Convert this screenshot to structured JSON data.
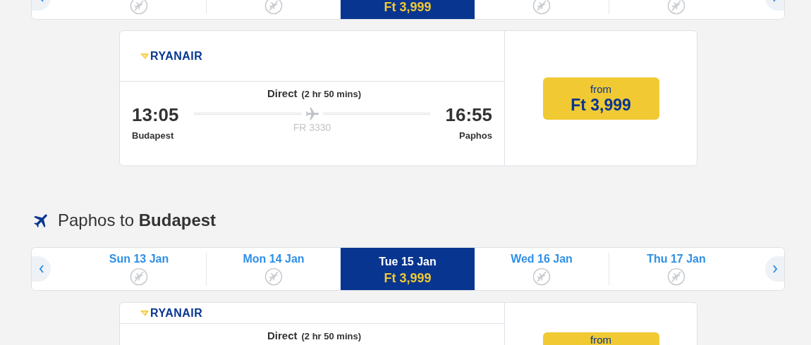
{
  "sections": [
    {
      "date_strip": {
        "days": [
          {
            "selected": false,
            "available": false
          },
          {
            "selected": false,
            "available": false
          },
          {
            "selected": true,
            "available": true,
            "price": "Ft 3,999"
          },
          {
            "selected": false,
            "available": false
          },
          {
            "selected": false,
            "available": false
          }
        ]
      },
      "flight": {
        "airline": "RYANAIR",
        "stops": "Direct",
        "duration": "(2 hr 50 mins)",
        "depart_time": "13:05",
        "depart_city": "Budapest",
        "flight_no": "FR 3330",
        "arrive_time": "16:55",
        "arrive_city": "Paphos",
        "price_label": "from",
        "price": "Ft 3,999"
      }
    },
    {
      "heading": "Paphos to **Budapest**",
      "date_strip": {
        "days": [
          {
            "date": "Sun 13 Jan",
            "selected": false,
            "available": false
          },
          {
            "date": "Mon 14 Jan",
            "selected": false,
            "available": false
          },
          {
            "date": "Tue 15 Jan",
            "selected": true,
            "available": true,
            "price": "Ft 3,999"
          },
          {
            "date": "Wed 16 Jan",
            "selected": false,
            "available": false
          },
          {
            "date": "Thu 17 Jan",
            "selected": false,
            "available": false
          }
        ]
      },
      "flight": {
        "airline": "RYANAIR",
        "stops": "Direct",
        "duration": "(2 hr 50 mins)",
        "price_label": "from"
      }
    }
  ]
}
